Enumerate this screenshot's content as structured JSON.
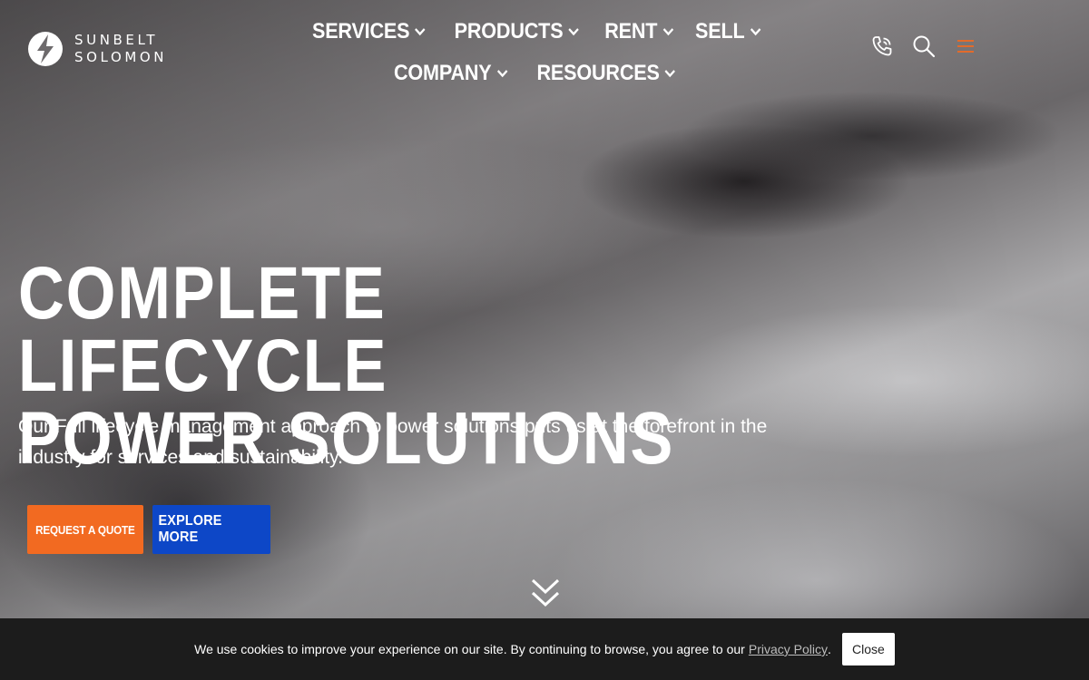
{
  "brand": {
    "line1": "SUNBELT",
    "line2": "SOLOMON"
  },
  "nav": {
    "items": [
      {
        "label": "SERVICES"
      },
      {
        "label": "PRODUCTS"
      },
      {
        "label": "RENT"
      },
      {
        "label": "SELL"
      },
      {
        "label": "COMPANY"
      },
      {
        "label": "RESOURCES"
      }
    ]
  },
  "header_icons": [
    "phone-icon",
    "search-icon",
    "hamburger-menu-icon"
  ],
  "hero": {
    "title_line1": "COMPLETE LIFECYCLE",
    "title_line2": "POWER SOLUTIONS",
    "subtitle": "Our Full lifecycle management approach to power solutions puts us at the forefront in the industry for services and sustainability.",
    "primary_button": "REQUEST A QUOTE",
    "secondary_button": "EXPLORE MORE"
  },
  "cookie_banner": {
    "text": "We use cookies to improve your experience on our site. By continuing to browse, you agree to our",
    "link": "Privacy Policy",
    "suffix": ".",
    "close_button": "Close"
  },
  "colors": {
    "accent_orange": "#f26a21",
    "accent_blue": "#0d47c7",
    "cookie_bg": "#1c1c1c"
  }
}
